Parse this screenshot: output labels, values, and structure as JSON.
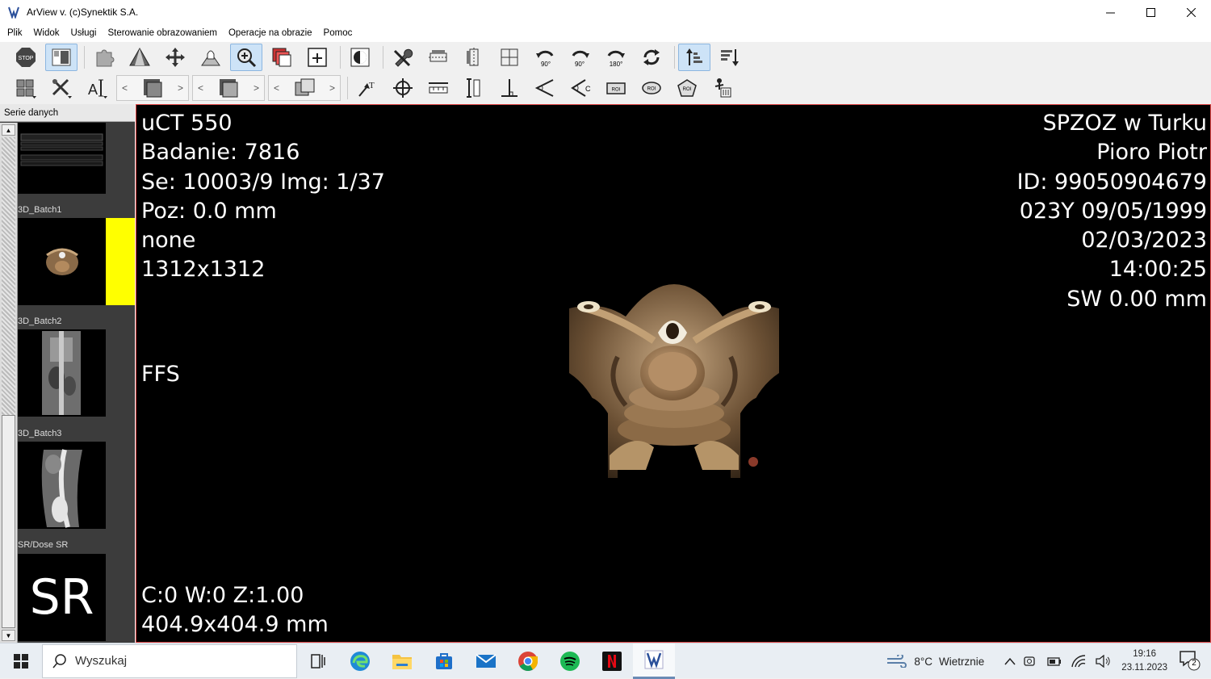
{
  "window": {
    "title": "ArView v. (c)Synektik S.A."
  },
  "menu": [
    "Plik",
    "Widok",
    "Usługi",
    "Sterowanie obrazowaniem",
    "Operacje na obrazie",
    "Pomoc"
  ],
  "toolbar": {
    "stop_label": "STOP",
    "rotate_labels": [
      "90°",
      "90°",
      "180°"
    ],
    "roi_label": "ROI",
    "nav_prev": "<",
    "nav_next": ">"
  },
  "sidebar": {
    "header": "Serie danych",
    "series": [
      {
        "label": "",
        "kind": "report"
      },
      {
        "label": "3D_Batch1",
        "kind": "render",
        "selected": true
      },
      {
        "label": "3D_Batch2",
        "kind": "ct-coronal"
      },
      {
        "label": "3D_Batch3",
        "kind": "ct-sagittal"
      },
      {
        "label": "SR/Dose SR",
        "kind": "sr",
        "text": "SR"
      }
    ]
  },
  "viewer": {
    "top_left": [
      "uCT 550",
      "Badanie: 7816",
      "Se: 10003/9 Img: 1/37",
      "Poz: 0.0 mm",
      "none",
      "1312x1312"
    ],
    "top_right": [
      "SPZOZ w Turku",
      "Pioro Piotr",
      "ID: 99050904679",
      "023Y 09/05/1999",
      "02/03/2023",
      "14:00:25",
      "SW 0.00 mm"
    ],
    "orientation": "FFS",
    "bottom_left": [
      "C:0 W:0 Z:1.00",
      "404.9x404.9 mm"
    ]
  },
  "taskbar": {
    "search_placeholder": "Wyszukaj",
    "weather_temp": "8°C",
    "weather_desc": "Wietrznie",
    "time": "19:16",
    "date": "23.11.2023",
    "notifications": "2"
  },
  "colors": {
    "viewer_border": "#dd4444",
    "selected_marker": "#ffff00",
    "bone": "#b49670"
  }
}
